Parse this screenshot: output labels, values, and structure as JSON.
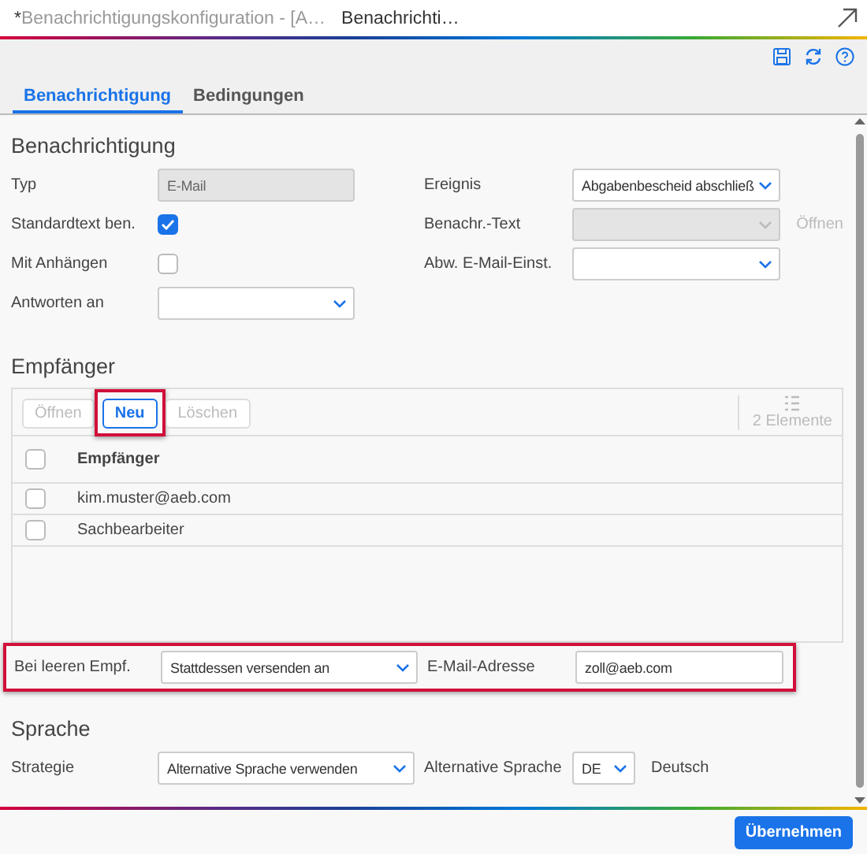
{
  "title_bar": {
    "dirty_mark": "*",
    "title": "Benachrichtigungskonfiguration - [A…",
    "subtitle": "Benachrichti…"
  },
  "tabs": [
    {
      "label": "Benachrichtigung",
      "selected": true
    },
    {
      "label": "Bedingungen",
      "selected": false
    }
  ],
  "notification": {
    "heading": "Benachrichtigung",
    "rows": [
      {
        "left": {
          "label": "Typ",
          "kind": "text",
          "value": "E-Mail",
          "disabled": true
        },
        "right": {
          "label": "Ereignis",
          "kind": "select",
          "value": "Abgabenbescheid abschließ",
          "disabled": false
        }
      },
      {
        "left": {
          "label": "Standardtext ben.",
          "kind": "checkbox",
          "checked": true
        },
        "right": {
          "label": "Benachr.-Text",
          "kind": "select",
          "disabled": true,
          "link": "Öffnen"
        }
      },
      {
        "left": {
          "label": "Mit Anhängen",
          "kind": "checkbox",
          "checked": false
        },
        "right": {
          "label": "Abw. E-Mail-Einst.",
          "kind": "select",
          "disabled": false
        }
      },
      {
        "left": {
          "label": "Antworten an",
          "kind": "select",
          "disabled": false
        }
      }
    ]
  },
  "recipients": {
    "heading": "Empfänger",
    "buttons": [
      {
        "label": "Öffnen",
        "disabled": true,
        "highlighted": false
      },
      {
        "label": "Neu",
        "disabled": false,
        "highlighted": true
      },
      {
        "label": "Löschen",
        "disabled": true,
        "highlighted": false
      }
    ],
    "count": "2 Elemente",
    "column": "Empfänger",
    "all_checked": false,
    "rows": [
      {
        "text": "kim.muster@aeb.com",
        "checked": false
      },
      {
        "text": "Sachbearbeiter",
        "checked": false
      }
    ],
    "empty_row": {
      "highlighted": true,
      "left": {
        "label": "Bei leeren Empf.",
        "value": "Stattdessen versenden an"
      },
      "right": {
        "label": "E-Mail-Adresse",
        "value": "zoll@aeb.com"
      }
    }
  },
  "language": {
    "heading": "Sprache",
    "label": "Strategie",
    "value": "Alternative Sprache verwenden",
    "alt_label": "Alternative Sprache",
    "alt_value": "DE",
    "alt_name": "Deutsch"
  },
  "apply_button": "Übernehmen"
}
